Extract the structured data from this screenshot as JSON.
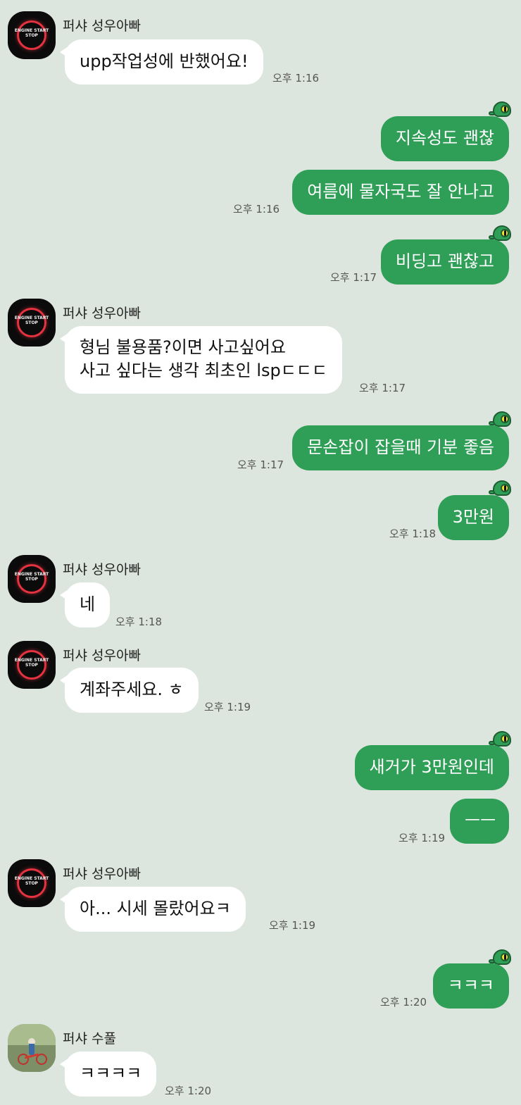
{
  "contacts": {
    "seongwoo": {
      "name": "퍼샤 성우아빠",
      "avatar_text": "ENGINE START STOP",
      "avatar_icon": "engine-start-button-icon"
    },
    "supul": {
      "name": "퍼샤 수풀",
      "avatar_icon": "child-on-bike-photo"
    }
  },
  "colors": {
    "background": "#dde6de",
    "outgoing_bubble": "#2f9e57",
    "incoming_bubble": "#ffffff"
  },
  "messages": [
    {
      "sender": "퍼샤 성우아빠",
      "text": "upp작업성에 반했어요!",
      "time": "오후 1:16"
    },
    {
      "sender": "me",
      "text": "지속성도 괜찮",
      "time": ""
    },
    {
      "sender": "me",
      "text": "여름에 물자국도 잘 안나고",
      "time": "오후 1:16"
    },
    {
      "sender": "me",
      "text": "비딩고 괜찮고",
      "time": "오후 1:17"
    },
    {
      "sender": "퍼샤 성우아빠",
      "text_line1": "형님 불용품?이면 사고싶어요",
      "text_line2": "사고 싶다는 생각 최초인 lspㄷㄷㄷ",
      "time": "오후 1:17"
    },
    {
      "sender": "me",
      "text": "문손잡이 잡을때 기분 좋음",
      "time": "오후 1:17"
    },
    {
      "sender": "me",
      "text": "3만원",
      "time": "오후 1:18"
    },
    {
      "sender": "퍼샤 성우아빠",
      "text": "네",
      "time": "오후 1:18"
    },
    {
      "sender": "퍼샤 성우아빠",
      "text": "계좌주세요. ㅎ",
      "time": "오후 1:19"
    },
    {
      "sender": "me",
      "text": "새거가 3만원인데",
      "time": ""
    },
    {
      "sender": "me",
      "text": "ㅡㅡ",
      "time": "오후 1:19"
    },
    {
      "sender": "퍼샤 성우아빠",
      "text": "아... 시세 몰랐어요ㅋ",
      "time": "오후 1:19"
    },
    {
      "sender": "me",
      "text": "ㅋㅋㅋ",
      "time": "오후 1:20"
    },
    {
      "sender": "퍼샤 수풀",
      "text": "ㅋㅋㅋㅋ",
      "time": "오후 1:20"
    }
  ]
}
